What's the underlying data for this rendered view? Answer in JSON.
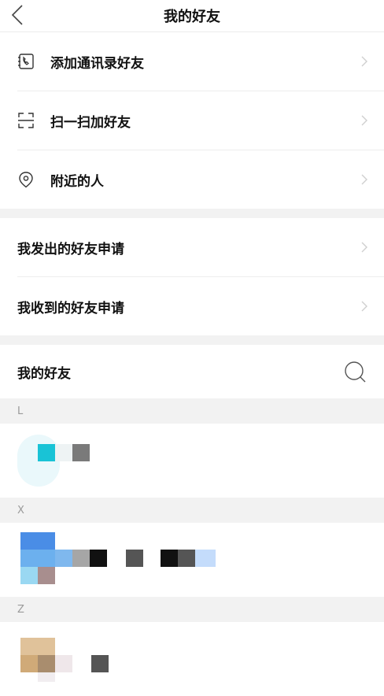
{
  "header": {
    "title": "我的好友",
    "back_icon": "chevron-left-icon"
  },
  "menu_top": [
    {
      "label": "添加通讯录好友",
      "icon": "contacts-phone-icon"
    },
    {
      "label": "扫一扫加好友",
      "icon": "scan-icon"
    },
    {
      "label": "附近的人",
      "icon": "location-pin-icon"
    }
  ],
  "menu_requests": [
    {
      "label": "我发出的好友申请"
    },
    {
      "label": "我收到的好友申请"
    }
  ],
  "friends_section": {
    "title": "我的好友",
    "search_icon": "search-icon"
  },
  "groups": [
    {
      "letter": "L"
    },
    {
      "letter": "X"
    },
    {
      "letter": "Z"
    }
  ],
  "colors": {
    "divider": "#ededed",
    "gap": "#f2f2f2",
    "chevron": "#cfcfcf"
  }
}
